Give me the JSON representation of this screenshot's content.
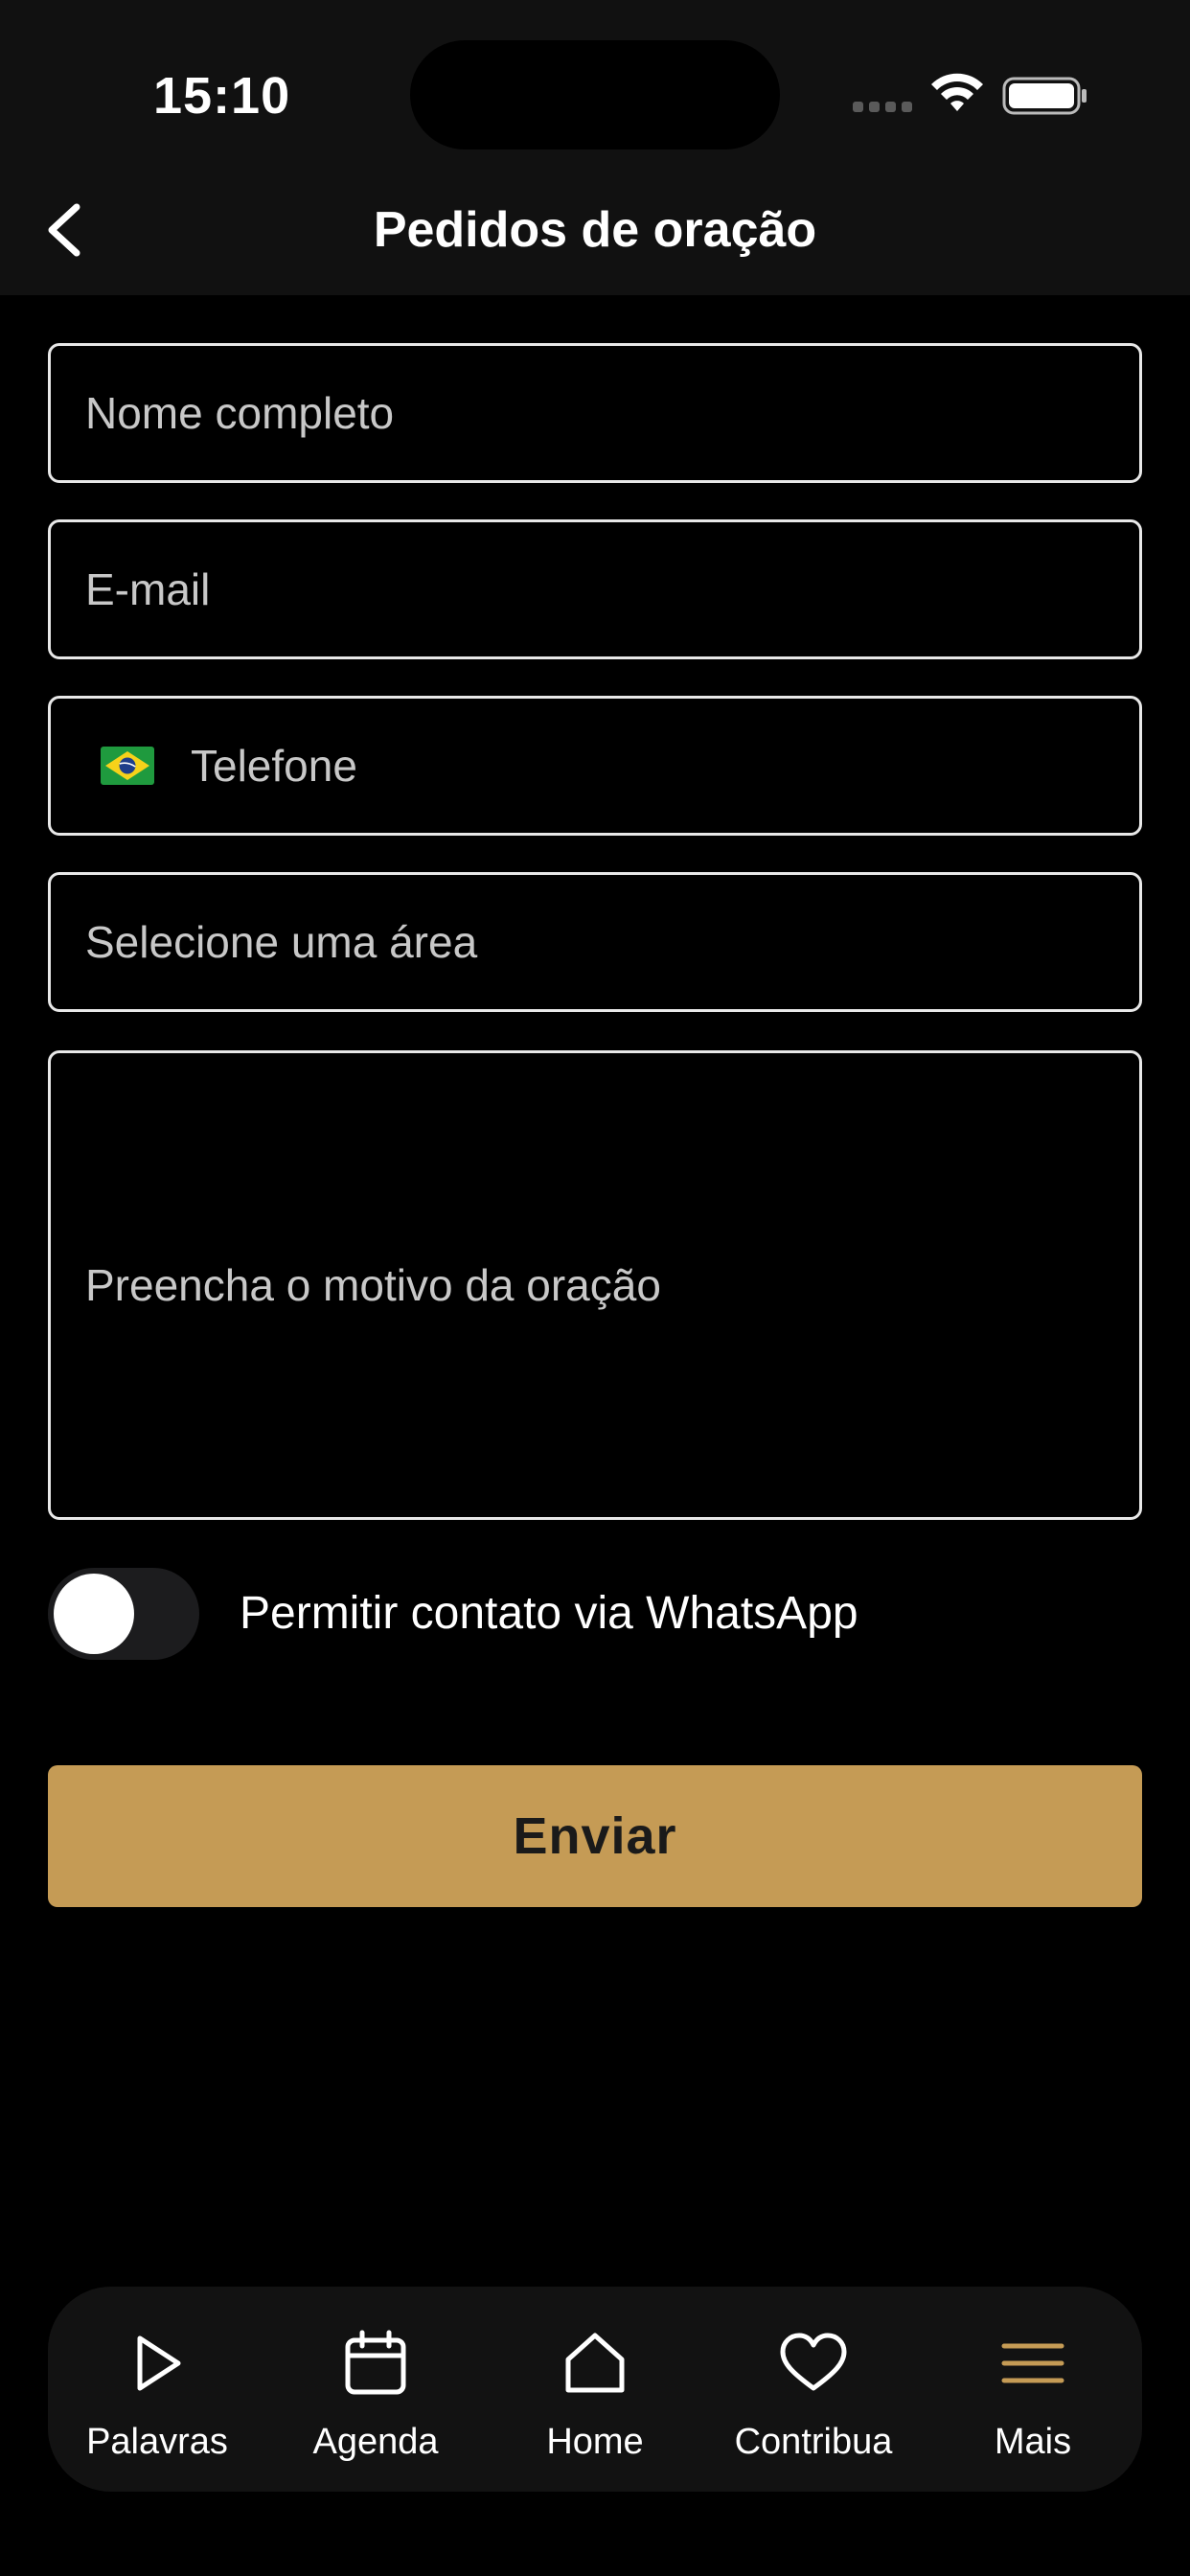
{
  "status_bar": {
    "time": "15:10"
  },
  "header": {
    "title": "Pedidos de oração"
  },
  "form": {
    "name_placeholder": "Nome completo",
    "email_placeholder": "E-mail",
    "phone_placeholder": "Telefone",
    "area_placeholder": "Selecione uma área",
    "reason_placeholder": "Preencha o motivo da oração",
    "whatsapp_label": "Permitir contato via WhatsApp",
    "whatsapp_enabled": false,
    "submit_label": "Enviar"
  },
  "tab_bar": {
    "items": [
      {
        "label": "Palavras",
        "icon": "play-icon"
      },
      {
        "label": "Agenda",
        "icon": "calendar-icon"
      },
      {
        "label": "Home",
        "icon": "home-icon"
      },
      {
        "label": "Contribua",
        "icon": "heart-icon"
      },
      {
        "label": "Mais",
        "icon": "menu-icon"
      }
    ]
  },
  "colors": {
    "accent": "#c59b55",
    "background": "#000000",
    "header_bg": "#111111",
    "tab_bar_bg": "#121212"
  }
}
